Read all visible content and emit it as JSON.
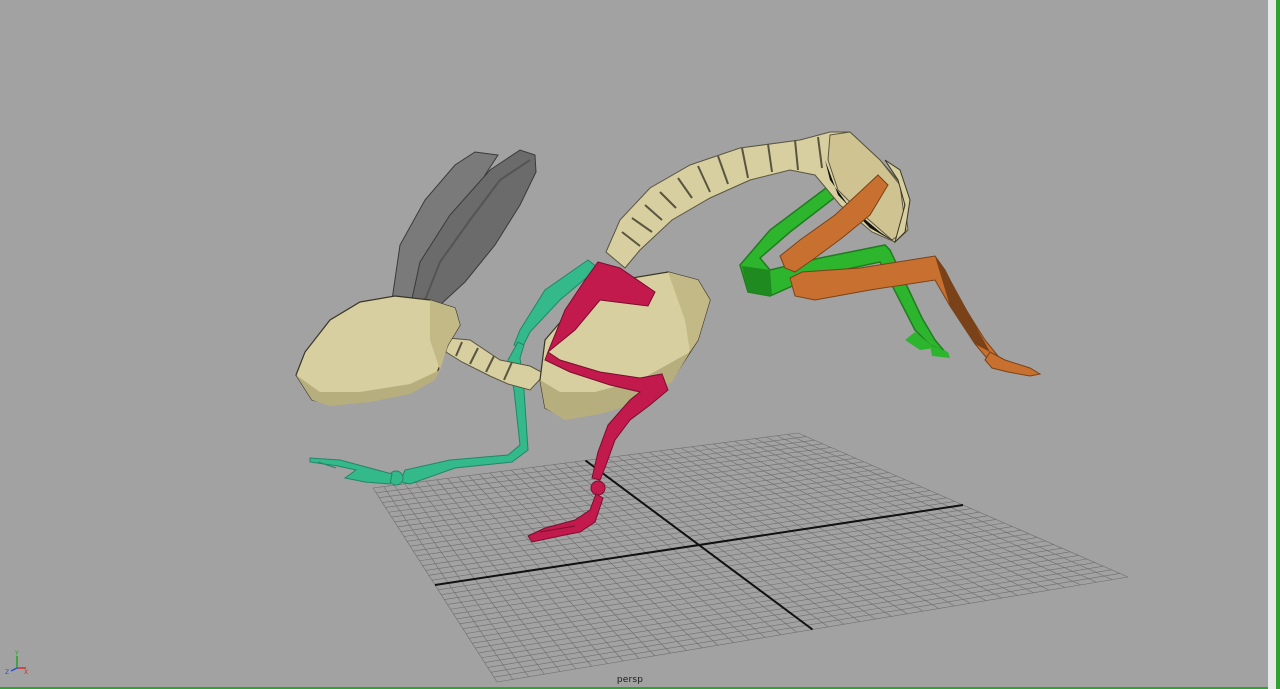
{
  "viewport": {
    "camera_label": "persp",
    "background_color": "#a2a2a2",
    "active_panel_color": "#2fa32f"
  },
  "axis_gizmo": {
    "x_label": "X",
    "y_label": "Y",
    "z_label": "Z",
    "x_color": "#d03030",
    "y_color": "#28a028",
    "z_color": "#2850d0"
  },
  "rig": {
    "body_color": "#d8cfa0",
    "ear_color": "#6b6b6b",
    "front_leg_near_color": "#c21a4c",
    "front_leg_far_color": "#33b98a",
    "hind_leg_far_color": "#2db52d",
    "hind_leg_near_color": "#c8702f"
  }
}
